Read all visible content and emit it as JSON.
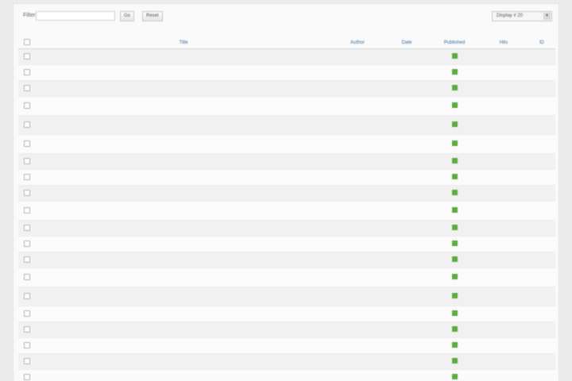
{
  "toolbar": {
    "filter_label": "Filter",
    "filter_value": "",
    "go_label": "Go",
    "reset_label": "Reset",
    "display_label": "Display #",
    "display_value": "20"
  },
  "table": {
    "headers": [
      "#",
      "Title",
      "Author",
      "Date",
      "Published",
      "Hits",
      "ID"
    ],
    "rows": [
      {
        "title": "",
        "author": "",
        "date": "",
        "hits": "",
        "id": ""
      },
      {
        "title": "",
        "author": "",
        "date": "",
        "hits": "",
        "id": ""
      },
      {
        "title": "",
        "author": "",
        "date": "",
        "hits": "",
        "id": ""
      },
      {
        "title": "",
        "author": "",
        "date": "",
        "hits": "",
        "id": ""
      },
      {
        "title": "",
        "author": "",
        "date": "",
        "hits": "",
        "id": ""
      },
      {
        "title": "",
        "author": "",
        "date": "",
        "hits": "",
        "id": ""
      },
      {
        "title": "",
        "author": "",
        "date": "",
        "hits": "",
        "id": ""
      },
      {
        "title": "",
        "author": "",
        "date": "",
        "hits": "",
        "id": ""
      },
      {
        "title": "",
        "author": "",
        "date": "",
        "hits": "",
        "id": ""
      },
      {
        "title": "",
        "author": "",
        "date": "",
        "hits": "",
        "id": ""
      },
      {
        "title": "",
        "author": "",
        "date": "",
        "hits": "",
        "id": ""
      },
      {
        "title": "",
        "author": "",
        "date": "",
        "hits": "",
        "id": ""
      },
      {
        "title": "",
        "author": "",
        "date": "",
        "hits": "",
        "id": ""
      },
      {
        "title": "",
        "author": "",
        "date": "",
        "hits": "",
        "id": ""
      },
      {
        "title": "",
        "author": "",
        "date": "",
        "hits": "",
        "id": ""
      },
      {
        "title": "",
        "author": "",
        "date": "",
        "hits": "",
        "id": ""
      },
      {
        "title": "",
        "author": "",
        "date": "",
        "hits": "",
        "id": ""
      },
      {
        "title": "",
        "author": "",
        "date": "",
        "hits": "",
        "id": ""
      },
      {
        "title": "",
        "author": "",
        "date": "",
        "hits": "",
        "id": ""
      },
      {
        "title": "",
        "author": "",
        "date": "",
        "hits": "",
        "id": ""
      }
    ]
  },
  "colors": {
    "link": "#2f6ab3",
    "published": "#5cab3e",
    "header_text": "#3a6ea5"
  }
}
